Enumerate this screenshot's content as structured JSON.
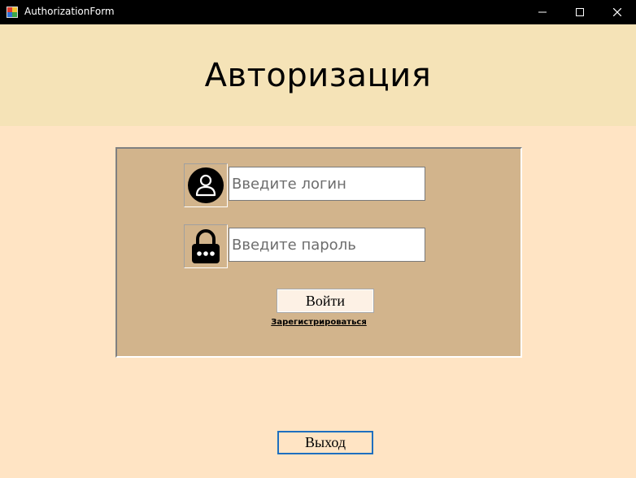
{
  "window": {
    "title": "AuthorizationForm",
    "icon": "winforms-app-icon",
    "controls": [
      "minimize-icon",
      "maximize-icon",
      "close-icon"
    ]
  },
  "header": {
    "title": "Авторизация"
  },
  "login_form": {
    "login_field": {
      "placeholder": "Введите логин",
      "value": "",
      "icon": "user-icon"
    },
    "password_field": {
      "placeholder": "Введите пароль",
      "value": "",
      "icon": "lock-icon"
    },
    "submit_label": "Войти",
    "register_link": "Зарегистрироваться"
  },
  "footer": {
    "exit_label": "Выход"
  },
  "colors": {
    "background": "#ffe4c4",
    "header": "#f5e3b7",
    "panel": "#d2b48c",
    "titlebar": "#000000",
    "focus_border": "#1e6fbf"
  }
}
